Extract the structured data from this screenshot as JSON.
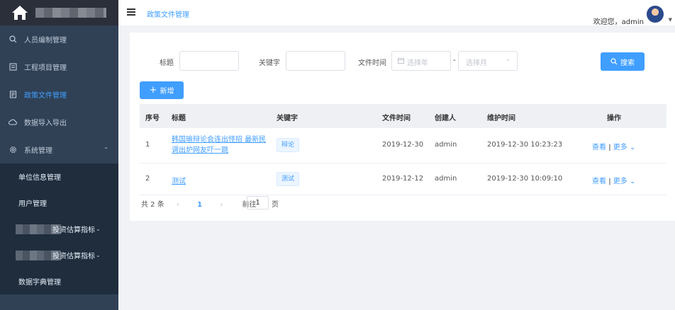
{
  "breadcrumb": "政策文件管理",
  "user": {
    "greeting": "欢迎您，admin"
  },
  "sidebar": {
    "menu": [
      {
        "label": "人员编制管理",
        "icon": "zoom-icon"
      },
      {
        "label": "工程项目管理",
        "icon": "document-box-icon"
      },
      {
        "label": "政策文件管理",
        "icon": "file-list-icon",
        "active": true
      },
      {
        "label": "数据导入导出",
        "icon": "cloud-transfer-icon"
      },
      {
        "label": "系统管理",
        "icon": "gear-icon",
        "expanded": true
      }
    ],
    "submenu": [
      {
        "label": "单位信息管理"
      },
      {
        "label": "用户管理"
      },
      {
        "label": "投资估算指标"
      },
      {
        "label": "投资估算指标"
      },
      {
        "label": "数据字典管理"
      }
    ]
  },
  "filters": {
    "title_label": "标题",
    "keyword_label": "关键字",
    "time_label": "文件时间",
    "year_placeholder": "选择年",
    "month_placeholder": "选择月",
    "separator": "-",
    "search_label": "搜索",
    "add_label": "新增"
  },
  "table": {
    "headers": [
      "序号",
      "标题",
      "关键字",
      "文件时间",
      "创建人",
      "维护时间",
      "操作"
    ],
    "rows": [
      {
        "index": "1",
        "title_line1": "韩国瑜辩论会连出怪招 最新民",
        "title_line2": "调出炉网友吓一跳",
        "keyword": "辩论",
        "file_time": "2019-12-30",
        "creator": "admin",
        "maintain_time": "2019-12-30 10:23:23",
        "view": "查看",
        "sep": "|",
        "more": "更多"
      },
      {
        "index": "2",
        "title_line1": "测试",
        "keyword": "测试",
        "file_time": "2019-12-12",
        "creator": "admin",
        "maintain_time": "2019-12-30 10:09:10",
        "view": "查看",
        "sep": "|",
        "more": "更多"
      }
    ]
  },
  "pagination": {
    "total": "共 2 条",
    "prev": "‹",
    "current": "1",
    "next": "›",
    "goto_label": "前往",
    "goto_value": "1",
    "page_suffix": "页"
  },
  "colors": {
    "primary": "#409eff",
    "sidebar": "#304156",
    "submenu": "#1f2d3d"
  }
}
